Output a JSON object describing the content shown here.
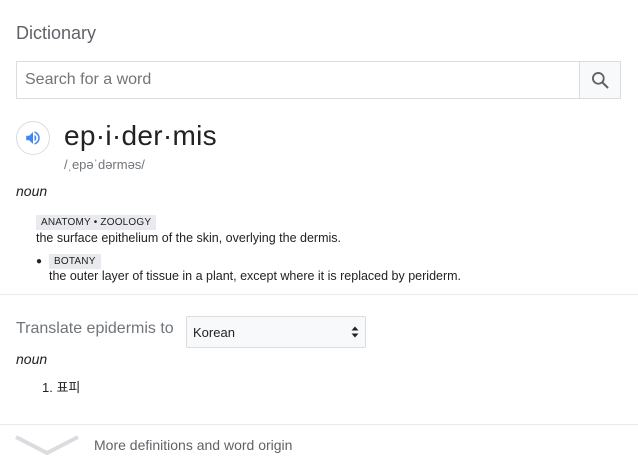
{
  "header": {
    "title": "Dictionary"
  },
  "search": {
    "placeholder": "Search for a word"
  },
  "entry": {
    "headword": "ep·i·der·mis",
    "phonetic": "/ˌepəˈdərməs/",
    "part_of_speech": "noun",
    "senses": [
      {
        "tag": "ANATOMY • ZOOLOGY",
        "definition": "the surface epithelium of the skin, overlying the dermis."
      },
      {
        "tag": "BOTANY",
        "definition": "the outer layer of tissue in a plant, except where it is replaced by periderm."
      }
    ]
  },
  "translate": {
    "label": "Translate epidermis to",
    "language": "Korean",
    "part_of_speech": "noun",
    "items": [
      "1. 표피"
    ]
  },
  "footer": {
    "more_label": "More definitions and word origin"
  },
  "icons": {
    "search": "search-icon",
    "audio": "speaker-icon",
    "chevron": "chevron-down-icon",
    "select": "select-arrows-icon"
  },
  "colors": {
    "accent": "#4285f4",
    "muted": "#70757a",
    "tag_bg": "#e8eaed"
  }
}
